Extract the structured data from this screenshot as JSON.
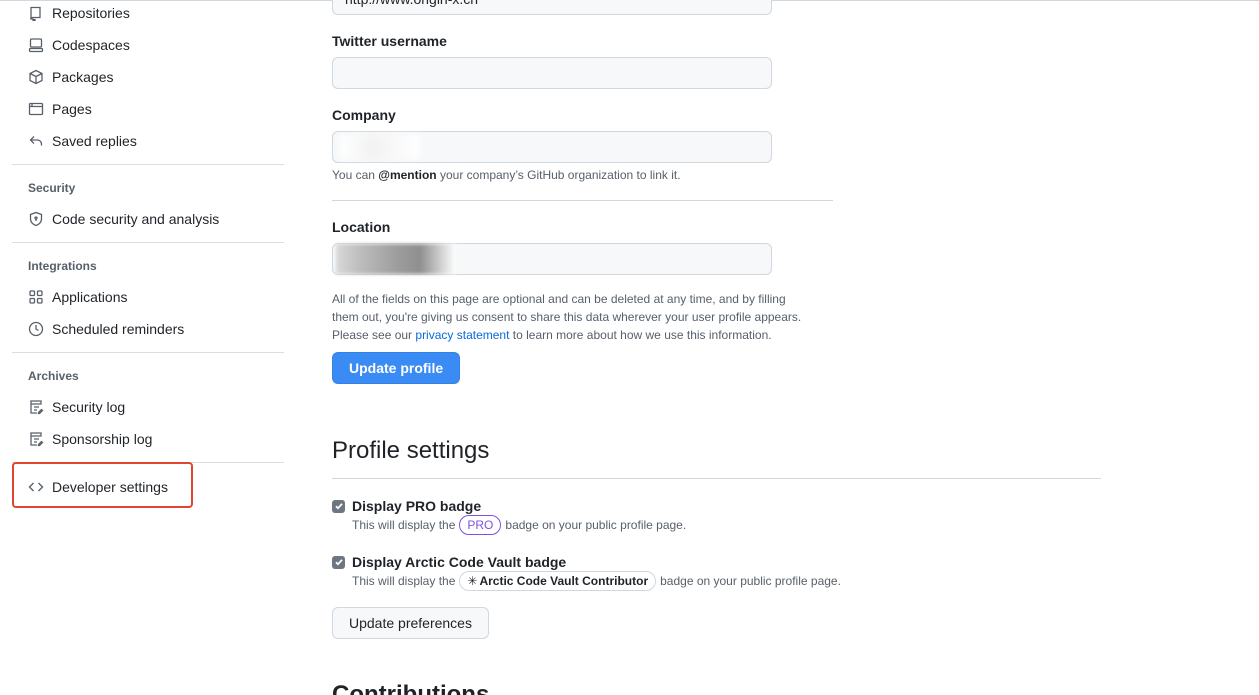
{
  "sidebar": {
    "items_top": [
      {
        "label": "Repositories",
        "icon": "repo-icon"
      },
      {
        "label": "Codespaces",
        "icon": "codespaces-icon"
      },
      {
        "label": "Packages",
        "icon": "package-icon"
      },
      {
        "label": "Pages",
        "icon": "browser-icon"
      },
      {
        "label": "Saved replies",
        "icon": "reply-icon"
      }
    ],
    "security_title": "Security",
    "security_items": [
      {
        "label": "Code security and analysis",
        "icon": "shield-icon"
      }
    ],
    "integrations_title": "Integrations",
    "integrations_items": [
      {
        "label": "Applications",
        "icon": "apps-icon"
      },
      {
        "label": "Scheduled reminders",
        "icon": "clock-icon"
      }
    ],
    "archives_title": "Archives",
    "archives_items": [
      {
        "label": "Security log",
        "icon": "log-icon"
      },
      {
        "label": "Sponsorship log",
        "icon": "log-icon"
      }
    ],
    "developer": {
      "label": "Developer settings",
      "icon": "code-icon"
    }
  },
  "form": {
    "url_value": "http://www.origin-x.cn",
    "twitter_label": "Twitter username",
    "twitter_value": "",
    "company_label": "Company",
    "company_value": "",
    "company_note_prefix": "You can ",
    "company_note_mention": "@mention",
    "company_note_suffix": " your company’s GitHub organization to link it.",
    "location_label": "Location",
    "location_value": "",
    "consent_line1": "All of the fields on this page are optional and can be deleted at any time, and by filling",
    "consent_line2": "them out, you're giving us consent to share this data wherever your user profile appears.",
    "consent_line3_prefix": "Please see our ",
    "consent_link": "privacy statement",
    "consent_line3_suffix": " to learn more about how we use this information.",
    "update_button": "Update profile"
  },
  "profile_settings": {
    "title": "Profile settings",
    "pro_label": "Display PRO badge",
    "pro_checked": true,
    "pro_note_prefix": "This will display the",
    "pro_badge": "PRO",
    "pro_note_suffix": "badge on your public profile page.",
    "vault_label": "Display Arctic Code Vault badge",
    "vault_checked": true,
    "vault_note_prefix": "This will display the",
    "vault_badge": "Arctic Code Vault Contributor",
    "vault_note_suffix": "badge on your public profile page.",
    "update_button": "Update preferences"
  },
  "next_section_title": "Contributions",
  "colors": {
    "primary_button": "#3b8bf5",
    "highlight_border": "#e0452f",
    "pro_badge": "#8250df",
    "link": "#0969da"
  }
}
